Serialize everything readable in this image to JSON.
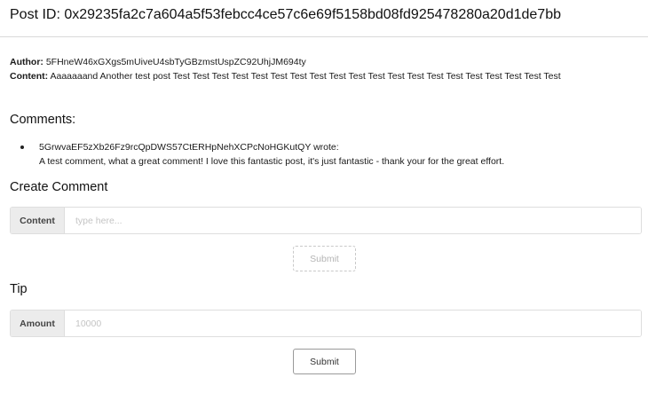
{
  "post": {
    "title": "Post ID: 0x29235fa2c7a604a5f53febcc4ce57c6e69f5158bd08fd925478280a20d1de7bb",
    "author_label": "Author:",
    "author": "5FHneW46xGXgs5mUiveU4sbTyGBzmstUspZC92UhjJM694ty",
    "content_label": "Content:",
    "content": "Aaaaaaand Another test post Test Test Test Test Test Test Test Test Test Test Test Test Test Test Test Test Test Test Test Test"
  },
  "comments": {
    "heading": "Comments:",
    "items": [
      {
        "author": "5GrwvaEF5zXb26Fz9rcQpDWS57CtERHpNehXCPcNoHGKutQY",
        "wrote": "wrote:",
        "text": "A test comment, what a great comment! I love this fantastic post, it's just fantastic - thank your for the great effort."
      }
    ]
  },
  "create_comment": {
    "heading": "Create Comment",
    "label": "Content",
    "placeholder": "type here...",
    "value": "",
    "submit_label": "Submit",
    "submit_enabled": false
  },
  "tip": {
    "heading": "Tip",
    "label": "Amount",
    "placeholder": "10000",
    "value": "",
    "submit_label": "Submit",
    "submit_enabled": true
  }
}
